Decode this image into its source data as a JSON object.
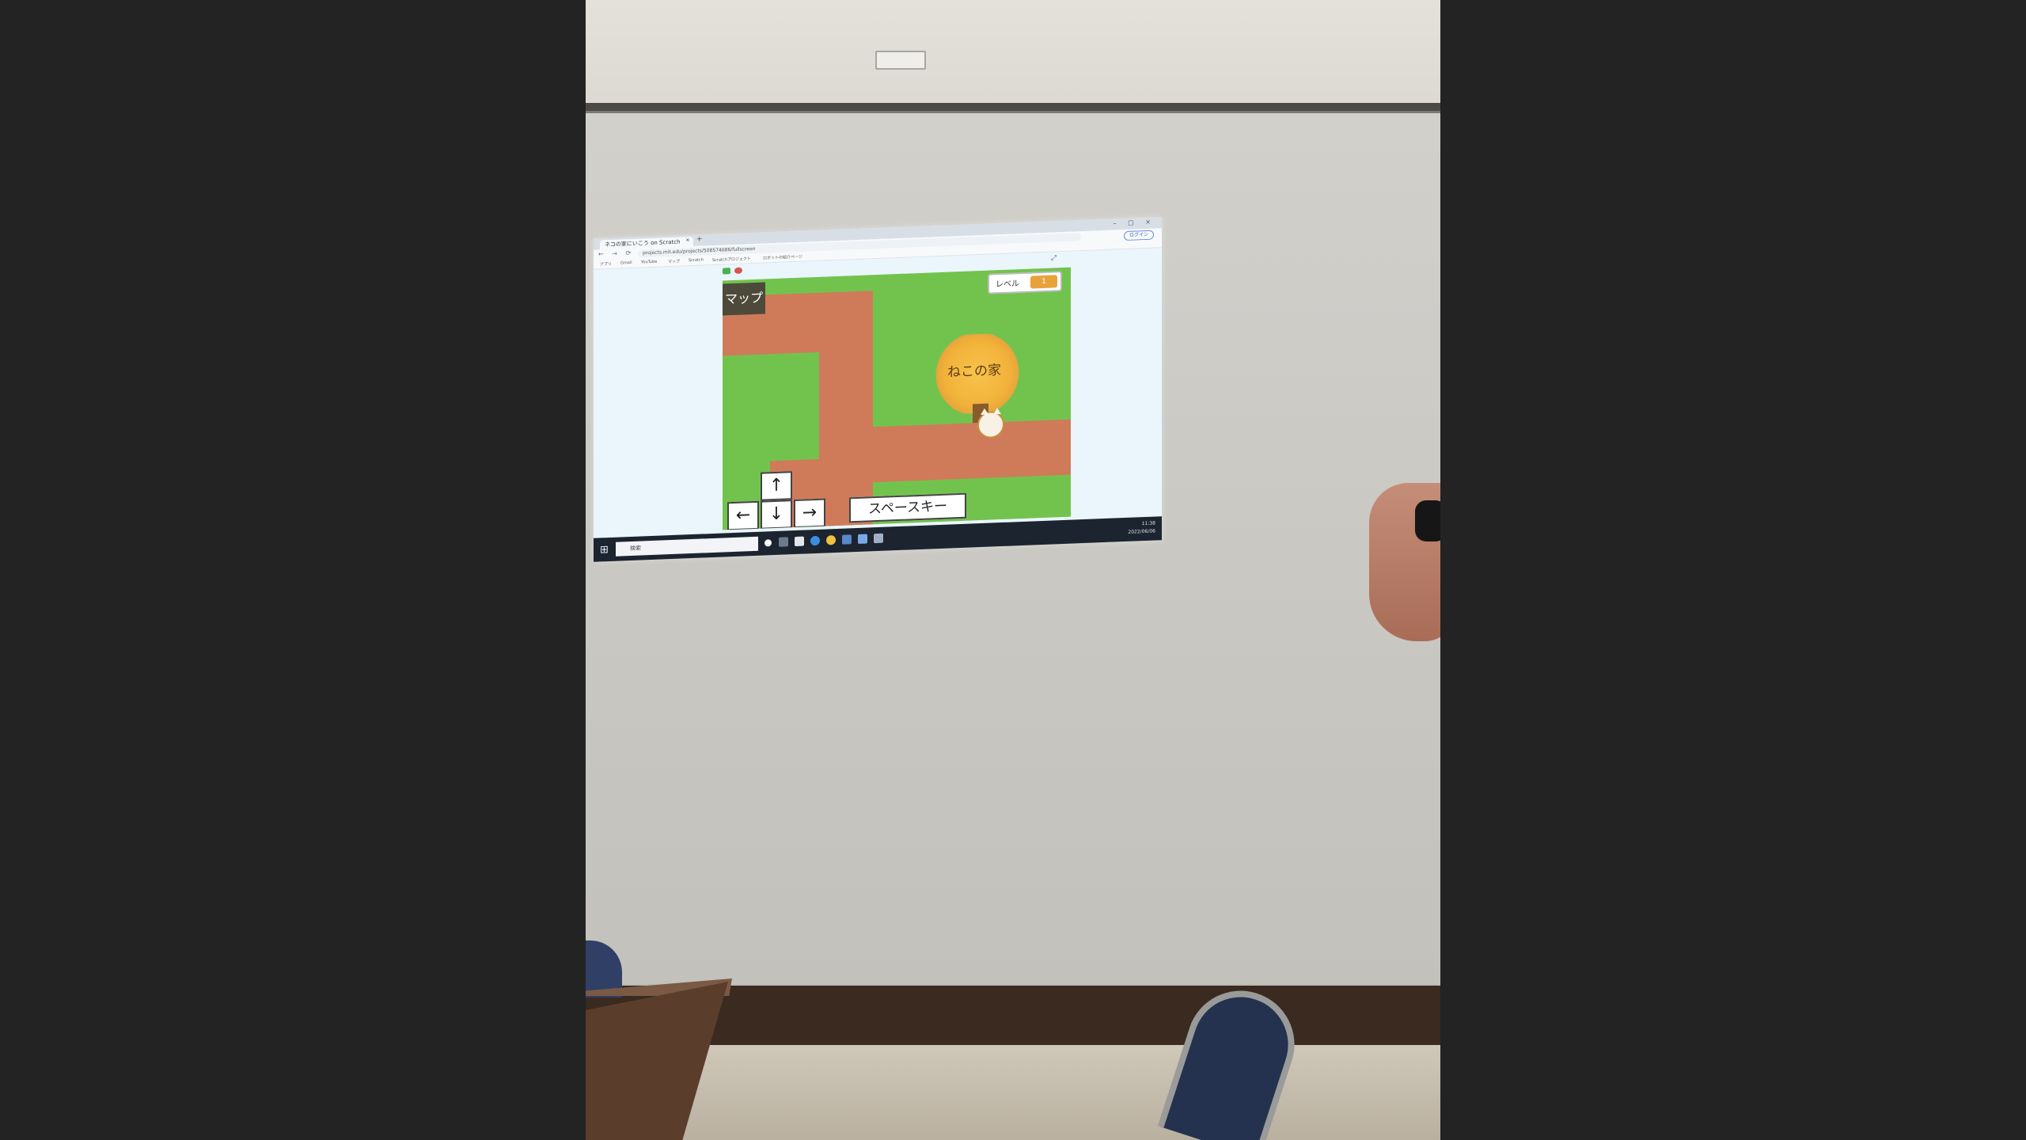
{
  "browser": {
    "tab_title": "ネコの家にいこう on Scratch",
    "url": "projects.mit.edu/projects/508574686/fullscreen",
    "sign_in_label": "ログイン",
    "bookmarks": [
      "アプリ",
      "Gmail",
      "YouTube",
      "マップ",
      "Scratch",
      "Scratchプロジェクト",
      "ロボットの紹介ページ"
    ]
  },
  "game": {
    "map_label": "マップ",
    "level_label": "レベル",
    "level_value": "1",
    "house_label": "ねこの家",
    "arrow_up": "↑",
    "arrow_left": "←",
    "arrow_down": "↓",
    "arrow_right": "→",
    "space_key_label": "スペースキー"
  },
  "taskbar": {
    "search_placeholder": "検索",
    "tray_time": "11:38",
    "tray_date": "2022/06/06"
  },
  "colors": {
    "grass": "#72c34d",
    "road": "#cf7b5a",
    "house": "#f2b23a",
    "taskbar": "#1c2430",
    "wall": "#cbc9c4"
  }
}
